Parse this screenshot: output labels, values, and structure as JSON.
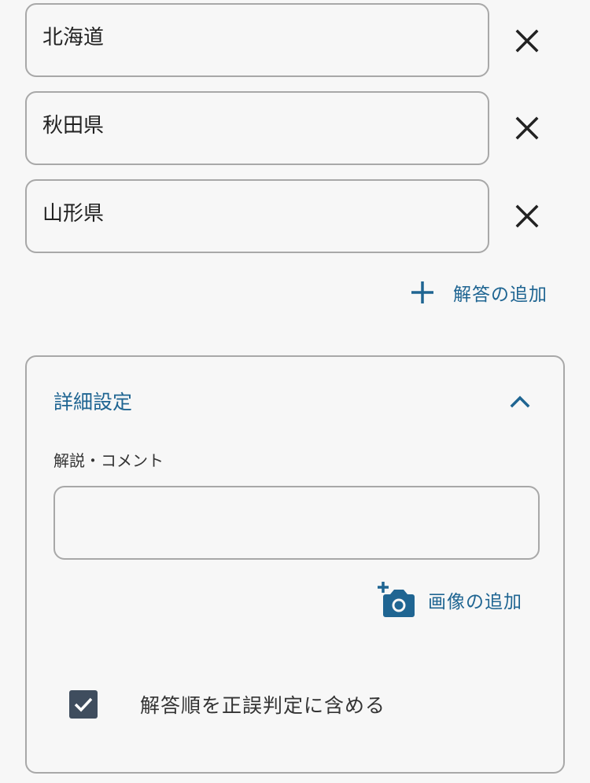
{
  "answers": [
    {
      "value": "北海道",
      "remove_icon": "close-icon"
    },
    {
      "value": "秋田県",
      "remove_icon": "close-icon"
    },
    {
      "value": "山形県",
      "remove_icon": "close-icon"
    }
  ],
  "add_answer": {
    "label": "解答の追加",
    "icon": "plus-icon"
  },
  "details": {
    "title": "詳細設定",
    "expanded": true,
    "toggle_icon": "chevron-up-icon",
    "comment_label": "解説・コメント",
    "comment_value": "",
    "add_image": {
      "label": "画像の追加",
      "icon": "add-photo-icon"
    },
    "order_option": {
      "label": "解答順を正誤判定に含める",
      "checked": true
    }
  },
  "colors": {
    "accent": "#1f6592",
    "border": "#a8a8a8",
    "checkbox": "#3f4d5e",
    "background": "#f7f7f7"
  }
}
